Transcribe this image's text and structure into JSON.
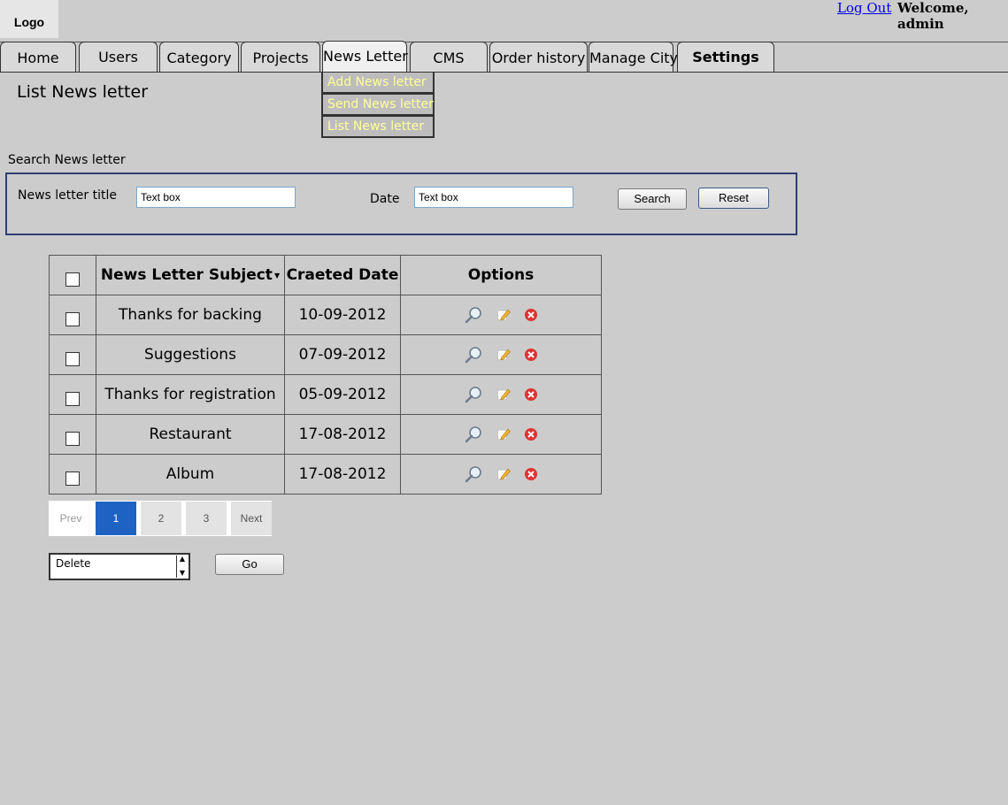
{
  "header": {
    "logo": "Logo",
    "logout": "Log Out",
    "welcome": "Welcome, admin"
  },
  "nav": {
    "tabs": [
      {
        "label": "Home"
      },
      {
        "label": "Users"
      },
      {
        "label": "Category"
      },
      {
        "label": "Projects"
      },
      {
        "label": "News Letter"
      },
      {
        "label": "CMS"
      },
      {
        "label": "Order history"
      },
      {
        "label": "Manage City"
      },
      {
        "label": "Settings"
      }
    ],
    "dropdown": [
      "Add News letter",
      "Send News letter",
      "List News letter"
    ]
  },
  "page": {
    "title": "List News letter"
  },
  "search": {
    "heading": "Search News letter",
    "title_label": "News letter title",
    "title_value": "Text box",
    "date_label": "Date",
    "date_value": "Text box",
    "search_button": "Search",
    "reset_button": "Reset"
  },
  "table": {
    "columns": [
      "News Letter Subject",
      "Craeted Date",
      "Options"
    ],
    "rows": [
      {
        "subject": "Thanks for backing",
        "date": "10-09-2012"
      },
      {
        "subject": "Suggestions",
        "date": "07-09-2012"
      },
      {
        "subject": "Thanks for registration",
        "date": "05-09-2012"
      },
      {
        "subject": "Restaurant",
        "date": "17-08-2012"
      },
      {
        "subject": "Album",
        "date": "17-08-2012"
      }
    ],
    "option_icons": [
      "view-icon",
      "edit-icon",
      "delete-icon"
    ]
  },
  "pagination": {
    "prev": "Prev",
    "pages": [
      "1",
      "2",
      "3"
    ],
    "current": "1",
    "next": "Next"
  },
  "bulk": {
    "action": "Delete",
    "go": "Go"
  },
  "colors": {
    "background": "#cccccc",
    "dropdown_text": "#ffff99",
    "active_page": "#1e63c4",
    "search_border": "#2e3e75",
    "link": "#0000ee"
  }
}
